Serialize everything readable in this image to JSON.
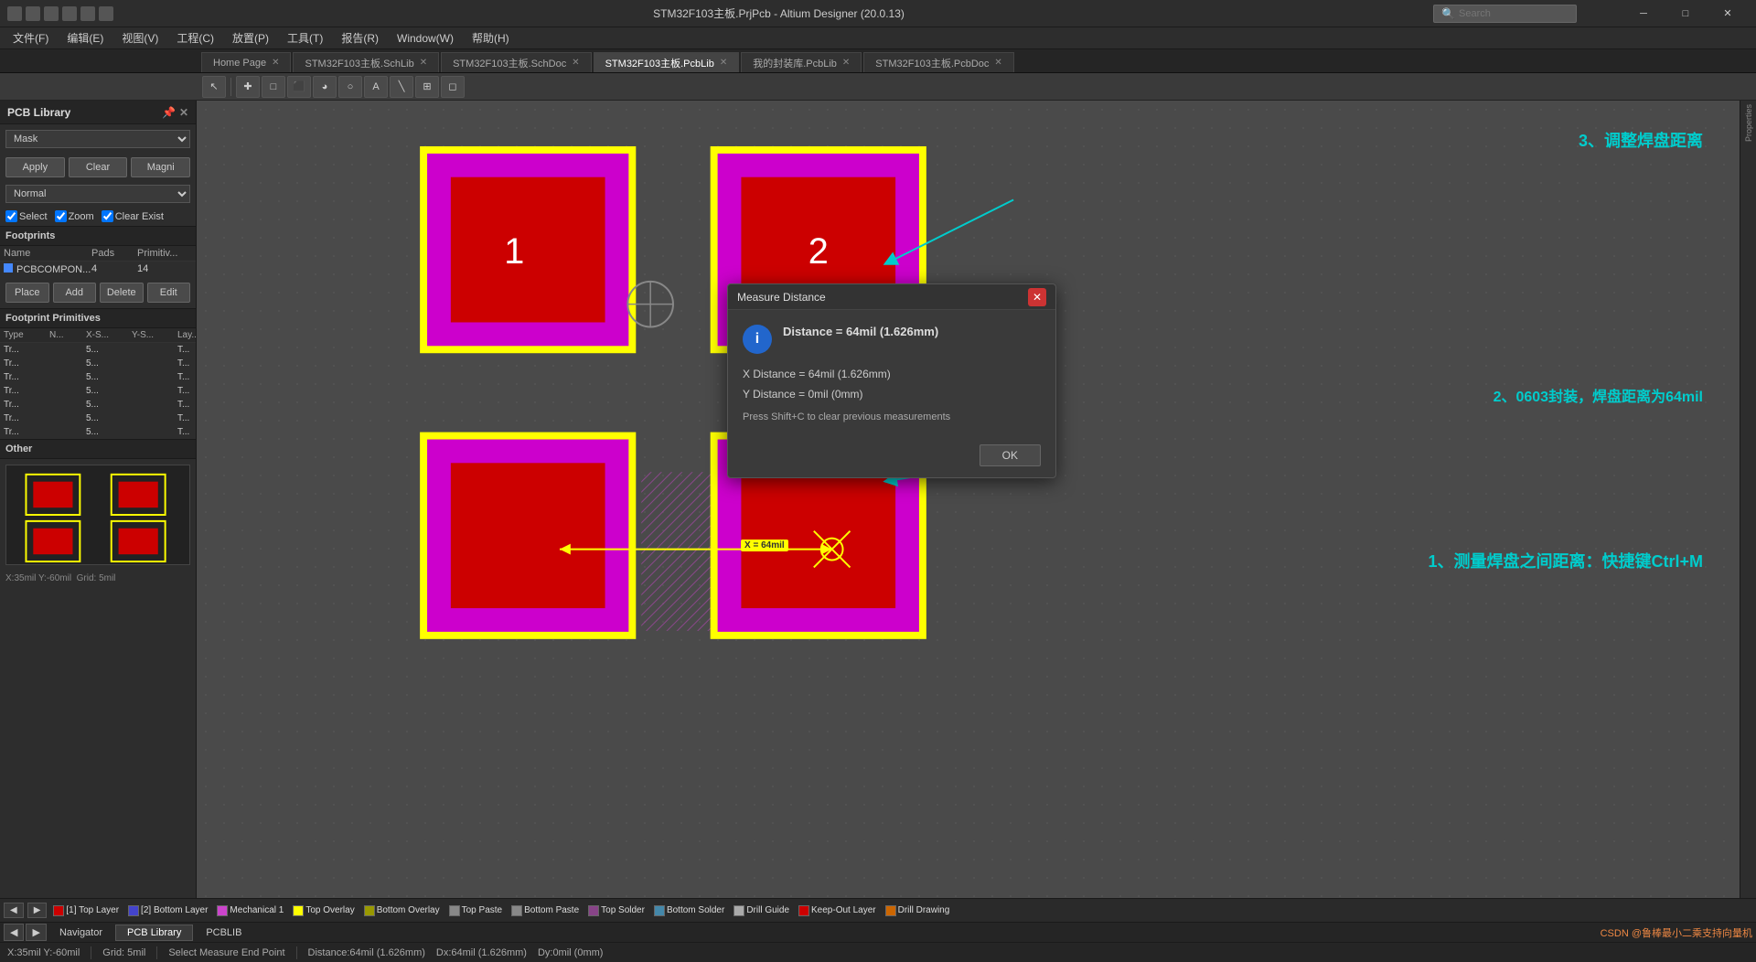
{
  "titlebar": {
    "title": "STM32F103主板.PrjPcb - Altium Designer (20.0.13)",
    "search_placeholder": "Search",
    "min_label": "─",
    "max_label": "□",
    "close_label": "✕"
  },
  "menubar": {
    "items": [
      {
        "label": "文件(F)"
      },
      {
        "label": "编辑(E)"
      },
      {
        "label": "视图(V)"
      },
      {
        "label": "工程(C)"
      },
      {
        "label": "放置(P)"
      },
      {
        "label": "工具(T)"
      },
      {
        "label": "报告(R)"
      },
      {
        "label": "Window(W)"
      },
      {
        "label": "帮助(H)"
      }
    ]
  },
  "tabs": [
    {
      "label": "Home Page",
      "active": false
    },
    {
      "label": "STM32F103主板.SchLib",
      "active": false
    },
    {
      "label": "STM32F103主板.SchDoc",
      "active": false
    },
    {
      "label": "STM32F103主板.PcbLib",
      "active": true
    },
    {
      "label": "我的封装库.PcbLib",
      "active": false
    },
    {
      "label": "STM32F103主板.PcbDoc",
      "active": false
    }
  ],
  "panel": {
    "title": "PCB Library",
    "mask_label": "Mask",
    "mask_options": [
      "Mask"
    ],
    "apply_label": "Apply",
    "clear_label": "Clear",
    "magni_label": "Magni",
    "normal_label": "Normal",
    "normal_options": [
      "Normal"
    ],
    "select_label": "Select",
    "zoom_label": "Zoom",
    "clear_exist_label": "Clear Exist",
    "footprints_label": "Footprints",
    "table_headers": [
      "Name",
      "Pads",
      "Primitiv..."
    ],
    "footprints": [
      {
        "name": "PCBCOMPON...",
        "pads": "4",
        "prims": "14"
      }
    ],
    "place_label": "Place",
    "add_label": "Add",
    "delete_label": "Delete",
    "edit_label": "Edit",
    "footprint_primitives_label": "Footprint Primitives",
    "prim_headers": [
      "Type",
      "N...",
      "X-S...",
      "Y-S...",
      "Lay..."
    ],
    "primitives": [
      {
        "type": "Tr...",
        "n": "",
        "xs": "5...",
        "ys": "",
        "lay": "T..."
      },
      {
        "type": "Tr...",
        "n": "",
        "xs": "5...",
        "ys": "",
        "lay": "T..."
      },
      {
        "type": "Tr...",
        "n": "",
        "xs": "5...",
        "ys": "",
        "lay": "T..."
      },
      {
        "type": "Tr...",
        "n": "",
        "xs": "5...",
        "ys": "",
        "lay": "T..."
      },
      {
        "type": "Tr...",
        "n": "",
        "xs": "5...",
        "ys": "",
        "lay": "T..."
      },
      {
        "type": "Tr...",
        "n": "",
        "xs": "5...",
        "ys": "",
        "lay": "T..."
      },
      {
        "type": "Tr...",
        "n": "",
        "xs": "5...",
        "ys": "",
        "lay": "T..."
      }
    ],
    "other_label": "Other"
  },
  "toolbar": {
    "buttons": [
      "▶",
      "◀",
      "✚",
      "□",
      "⬛",
      "▲",
      "◯",
      "✏",
      "╲",
      "⊞",
      "◻"
    ]
  },
  "dialog": {
    "title": "Measure Distance",
    "close_label": "✕",
    "info_icon": "i",
    "distance_label": "Distance = 64mil (1.626mm)",
    "x_distance_label": "X Distance = 64mil (1.626mm)",
    "y_distance_label": "Y Distance = 0mil (0mm)",
    "hint_label": "Press Shift+C to clear previous measurements",
    "ok_label": "OK"
  },
  "annotations": {
    "text1": "3、调整焊盘距离",
    "text2": "2、0603封装，焊盘距离为64mil",
    "text3": "1、测量焊盘之间距离：快捷键Ctrl+M"
  },
  "measure_label": "X = 64mil",
  "layerbar": {
    "nav_prev": "◀",
    "nav_next": "▶",
    "layers": [
      {
        "label": "[1] Top Layer",
        "color": "#cc0000"
      },
      {
        "label": "[2] Bottom Layer",
        "color": "#4444cc"
      },
      {
        "label": "Mechanical 1",
        "color": "#cc44cc"
      },
      {
        "label": "Top Overlay",
        "color": "#ffff00"
      },
      {
        "label": "Bottom Overlay",
        "color": "#999900"
      },
      {
        "label": "Top Paste",
        "color": "#888888"
      },
      {
        "label": "Bottom Paste",
        "color": "#888888"
      },
      {
        "label": "Top Solder",
        "color": "#884488"
      },
      {
        "label": "Bottom Solder",
        "color": "#4488aa"
      },
      {
        "label": "Drill Guide",
        "color": "#aaaaaa"
      },
      {
        "label": "Keep-Out Layer",
        "color": "#cc0000"
      },
      {
        "label": "Drill Drawing",
        "color": "#cc6600"
      }
    ]
  },
  "statusbar": {
    "coords": "X:35mil  Y:-60mil",
    "grid": "Grid: 5mil",
    "status_text": "Select Measure End Point",
    "distance": "Distance:64mil (1.626mm)",
    "dx": "Dx:64mil (1.626mm)",
    "dy": "Dy:0mil (0mm)",
    "right_text": "CSDN @鲁棒最小二乘支持向量机"
  },
  "nav_tabs": {
    "prev": "◀",
    "next": "▶",
    "items": [
      "Navigator",
      "PCB Library",
      "PCBLIB"
    ]
  }
}
